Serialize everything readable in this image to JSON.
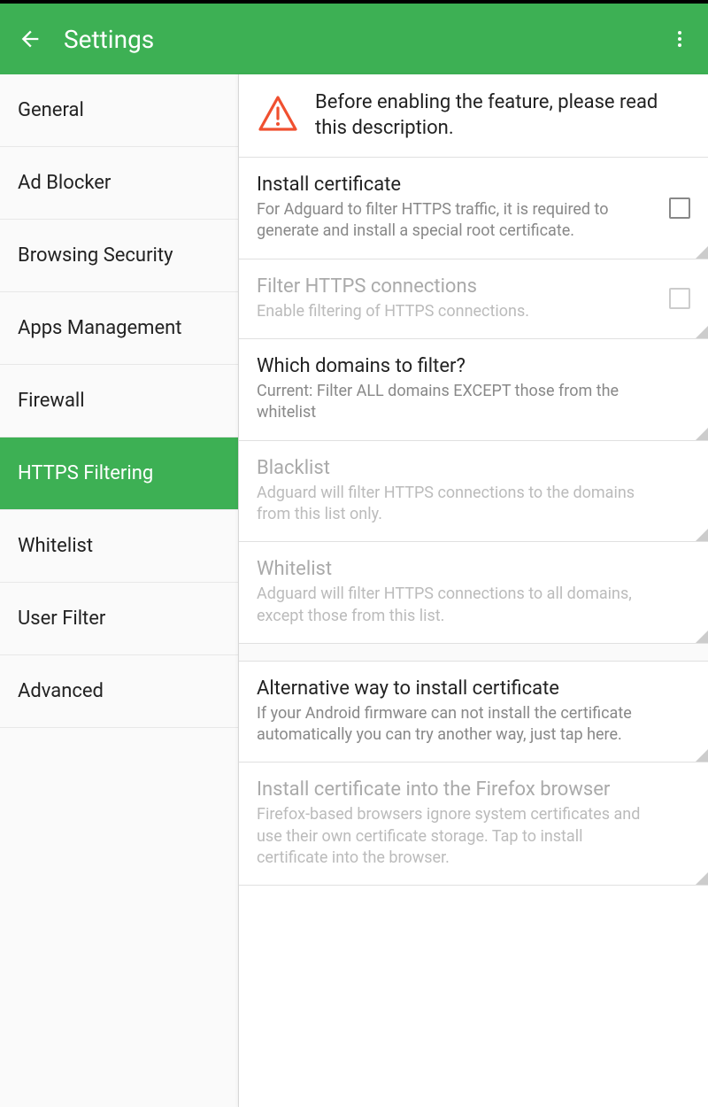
{
  "header": {
    "title": "Settings"
  },
  "sidebar": {
    "items": [
      {
        "label": "General"
      },
      {
        "label": "Ad Blocker"
      },
      {
        "label": "Browsing Security"
      },
      {
        "label": "Apps Management"
      },
      {
        "label": "Firewall"
      },
      {
        "label": "HTTPS Filtering"
      },
      {
        "label": "Whitelist"
      },
      {
        "label": "User Filter"
      },
      {
        "label": "Advanced"
      }
    ],
    "selected_index": 5
  },
  "content": {
    "warning": "Before enabling the feature, please read this description.",
    "rows": [
      {
        "title": "Install certificate",
        "desc": "For Adguard to filter HTTPS traffic, it is required to generate and install a special root certificate.",
        "has_checkbox": true
      },
      {
        "title": "Filter HTTPS connections",
        "desc": "Enable filtering of HTTPS connections.",
        "has_checkbox": true,
        "disabled": true
      },
      {
        "title": "Which domains to filter?",
        "desc": "Current: Filter ALL domains EXCEPT those from the whitelist"
      },
      {
        "title": "Blacklist",
        "desc": "Adguard will filter HTTPS connections to the domains from this list only.",
        "disabled": true
      },
      {
        "title": "Whitelist",
        "desc": "Adguard will filter HTTPS connections to all domains, except those from this list.",
        "disabled": true
      },
      {
        "title": "Alternative way to install certificate",
        "desc": "If your Android firmware can not install the certificate automatically you can try another way, just tap here."
      },
      {
        "title": "Install certificate into the Firefox browser",
        "desc": "Firefox-based browsers ignore system certificates and use their own certificate storage. Tap to install certificate into the browser.",
        "disabled": true
      }
    ]
  }
}
